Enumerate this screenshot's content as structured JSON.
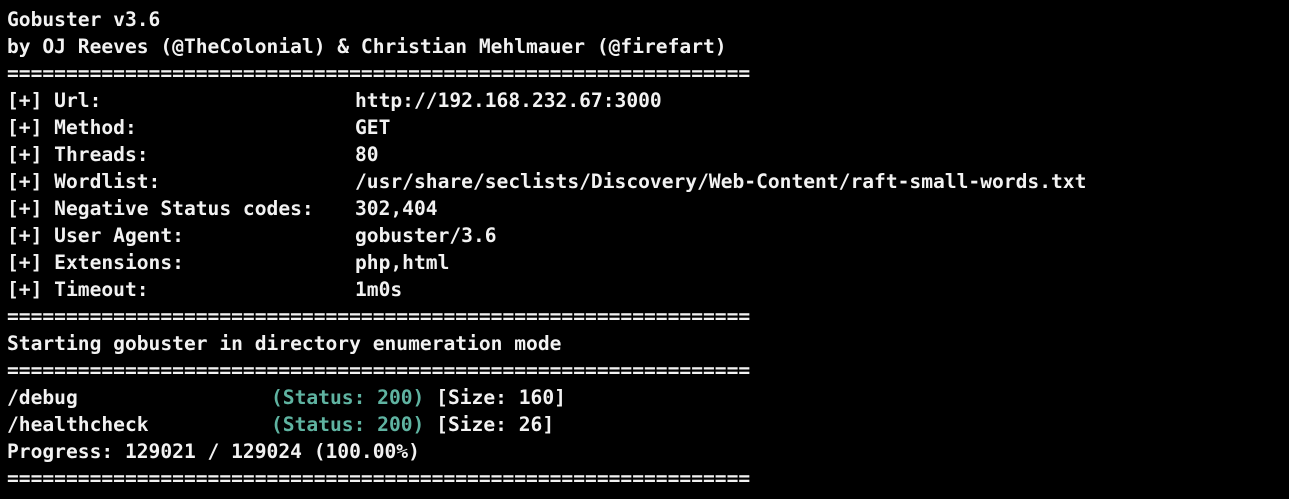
{
  "banner": {
    "title": "Gobuster v3.6",
    "authors": "by OJ Reeves (@TheColonial) & Christian Mehlmauer (@firefart)",
    "separator": "==============================================================="
  },
  "config": [
    {
      "key": "[+] Url:",
      "value": "http://192.168.232.67:3000"
    },
    {
      "key": "[+] Method:",
      "value": "GET"
    },
    {
      "key": "[+] Threads:",
      "value": "80"
    },
    {
      "key": "[+] Wordlist:",
      "value": "/usr/share/seclists/Discovery/Web-Content/raft-small-words.txt"
    },
    {
      "key": "[+] Negative Status codes:",
      "value": "302,404"
    },
    {
      "key": "[+] User Agent:",
      "value": "gobuster/3.6"
    },
    {
      "key": "[+] Extensions:",
      "value": "php,html"
    },
    {
      "key": "[+] Timeout:",
      "value": "1m0s"
    }
  ],
  "start_message": "Starting gobuster in directory enumeration mode",
  "results": [
    {
      "path": "/debug",
      "status": "(Status: 200)",
      "size": "[Size: 160]"
    },
    {
      "path": "/healthcheck",
      "status": "(Status: 200)",
      "size": "[Size: 26]"
    }
  ],
  "progress": "Progress: 129021 / 129024 (100.00%)",
  "colors": {
    "background": "#000000",
    "text": "#f2f2f2",
    "status": "#5fb3a1"
  }
}
